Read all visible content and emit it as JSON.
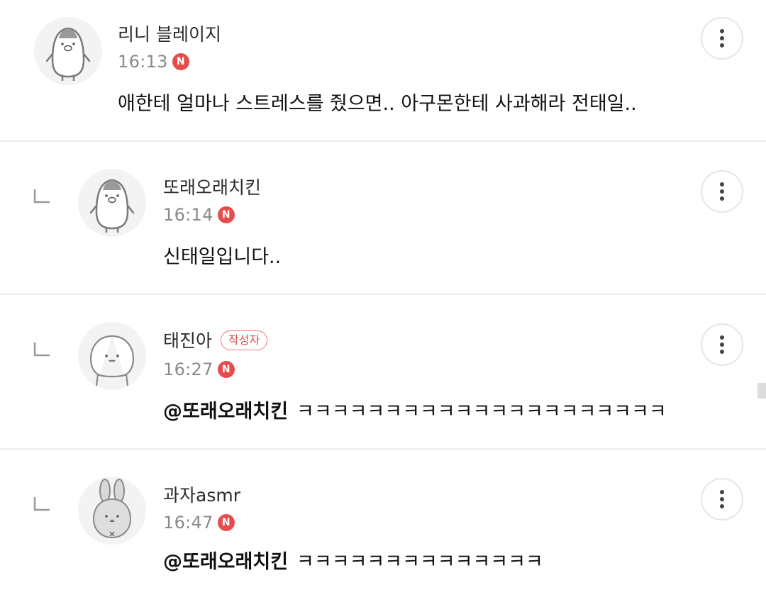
{
  "comments": [
    {
      "nickname": "리니 블레이지",
      "time": "16:13",
      "badge": "N",
      "text": "애한테 얼마나 스트레스를 줬으면.. 아구몬한테 사과해라 전태일..",
      "avatar_icon": "penguin-avatar-icon",
      "is_reply": false
    },
    {
      "nickname": "또래오래치킨",
      "time": "16:14",
      "badge": "N",
      "text": "신태일입니다..",
      "avatar_icon": "penguin-avatar-icon",
      "is_reply": true
    },
    {
      "nickname": "태진아",
      "author_badge": "작성자",
      "time": "16:27",
      "badge": "N",
      "mention": "@또래오래치킨",
      "text": "ㅋㅋㅋㅋㅋㅋㅋㅋㅋㅋㅋㅋㅋㅋㅋㅋㅋㅋㅋㅋㅋ",
      "avatar_icon": "blob-avatar-icon",
      "is_reply": true
    },
    {
      "nickname": "과자asmr",
      "time": "16:47",
      "badge": "N",
      "mention": "@또래오래치킨",
      "text": "ㅋㅋㅋㅋㅋㅋㅋㅋㅋㅋㅋㅋㅋㅋ",
      "avatar_icon": "rabbit-avatar-icon",
      "is_reply": true
    }
  ],
  "colors": {
    "new_badge": "#e74c4c",
    "author_badge": "#d94c4c",
    "divider": "#ececec",
    "time": "#8a8a8a"
  },
  "icons": {
    "more": "more-vertical-icon",
    "reply": "reply-arrow-icon"
  }
}
